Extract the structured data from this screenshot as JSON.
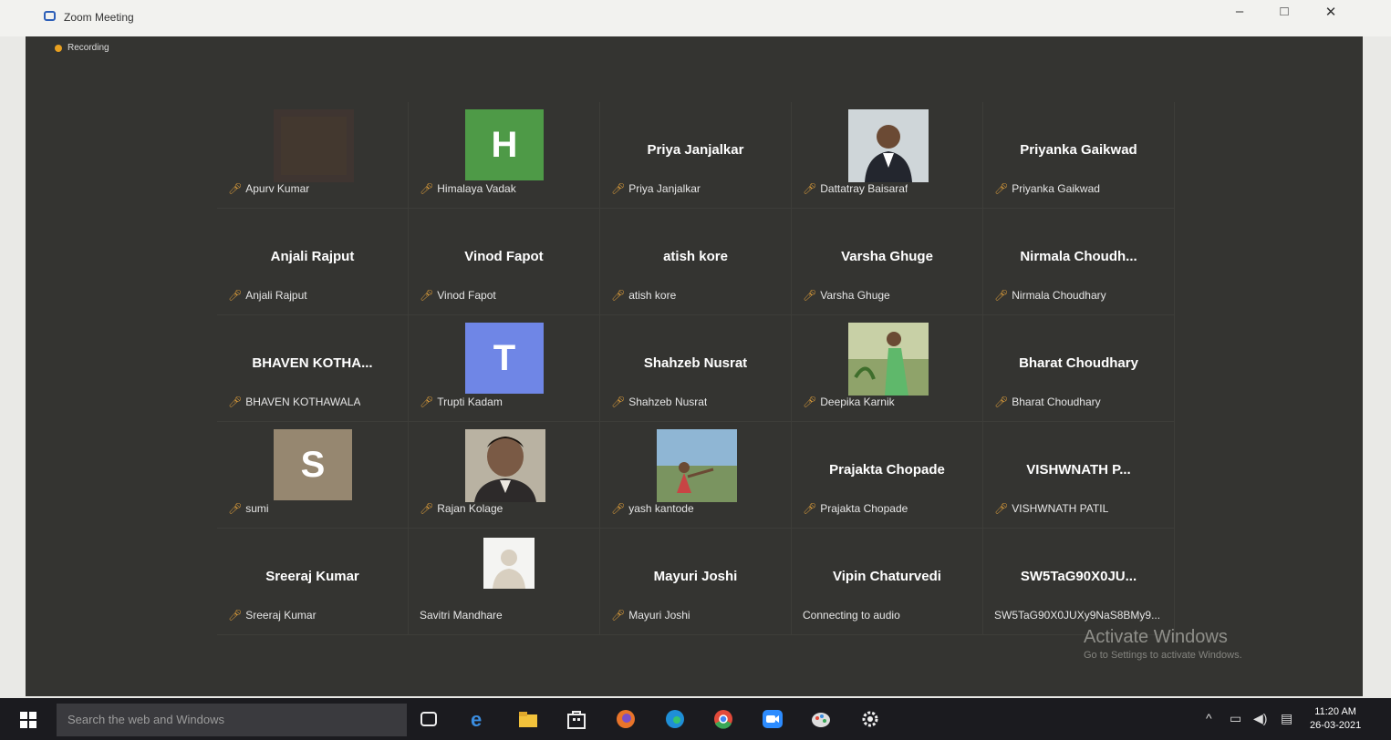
{
  "window": {
    "title": "Zoom Meeting",
    "minimize": "–",
    "maximize": "□",
    "close": "✕"
  },
  "meeting": {
    "recording_label": "Recording"
  },
  "tiles": [
    {
      "label": "Apurv Kumar",
      "kind": "photo",
      "photo": "dark-square"
    },
    {
      "label": "Himalaya Vadak",
      "kind": "avatar",
      "letter": "H",
      "color": "#4e9a47"
    },
    {
      "label": "Priya Janjalkar",
      "kind": "name",
      "display": "Priya Janjalkar"
    },
    {
      "label": "Dattatray Baisaraf",
      "kind": "photo",
      "photo": "man-portrait"
    },
    {
      "label": "Priyanka Gaikwad",
      "kind": "name",
      "display": "Priyanka Gaikwad"
    },
    {
      "label": "Anjali Rajput",
      "kind": "name",
      "display": "Anjali Rajput"
    },
    {
      "label": "Vinod Fapot",
      "kind": "name",
      "display": "Vinod Fapot"
    },
    {
      "label": "atish kore",
      "kind": "name",
      "display": "atish kore"
    },
    {
      "label": "Varsha Ghuge",
      "kind": "name",
      "display": "Varsha Ghuge"
    },
    {
      "label": "Nirmala Choudhary",
      "kind": "name",
      "display": "Nirmala Choudh..."
    },
    {
      "label": "BHAVEN KOTHAWALA",
      "kind": "name",
      "display": "BHAVEN KOTHA..."
    },
    {
      "label": "Trupti Kadam",
      "kind": "avatar",
      "letter": "T",
      "color": "#6f86e6"
    },
    {
      "label": "Shahzeb Nusrat",
      "kind": "name",
      "display": "Shahzeb Nusrat"
    },
    {
      "label": "Deepika Karnik",
      "kind": "photo",
      "photo": "woman-green"
    },
    {
      "label": "Bharat Choudhary",
      "kind": "name",
      "display": "Bharat Choudhary"
    },
    {
      "label": "sumi",
      "kind": "avatar",
      "letter": "S",
      "color": "#968770"
    },
    {
      "label": "Rajan Kolage",
      "kind": "photo",
      "photo": "man-closeup"
    },
    {
      "label": "yash kantode",
      "kind": "photo",
      "photo": "outdoor"
    },
    {
      "label": "Prajakta Chopade",
      "kind": "name",
      "display": "Prajakta Chopade"
    },
    {
      "label": "VISHWNATH PATIL",
      "kind": "name",
      "display": "VISHWNATH P..."
    },
    {
      "label": "Sreeraj Kumar",
      "kind": "name",
      "display": "Sreeraj Kumar"
    },
    {
      "label": "Savitri Mandhare",
      "kind": "photo",
      "photo": "default-avatar",
      "nomic": true
    },
    {
      "label": "Mayuri Joshi",
      "kind": "name",
      "display": "Mayuri Joshi"
    },
    {
      "label": "Connecting to audio",
      "kind": "name",
      "display": "Vipin Chaturvedi",
      "nomic": true
    },
    {
      "label": "SW5TaG90X0JUXy9NaS8BMy9...",
      "kind": "name",
      "display": "SW5TaG90X0JU...",
      "nomic": true
    }
  ],
  "watermark": {
    "title": "Activate Windows",
    "subtitle": "Go to Settings to activate Windows."
  },
  "taskbar": {
    "search_placeholder": "Search the web and Windows",
    "time": "11:20 AM",
    "date": "26-03-2021",
    "apps": [
      "task-view-icon",
      "edge-icon",
      "file-explorer-icon",
      "store-icon",
      "firefox-icon",
      "edge-chromium-icon",
      "chrome-icon",
      "zoom-icon",
      "paint-icon",
      "settings-icon"
    ]
  }
}
